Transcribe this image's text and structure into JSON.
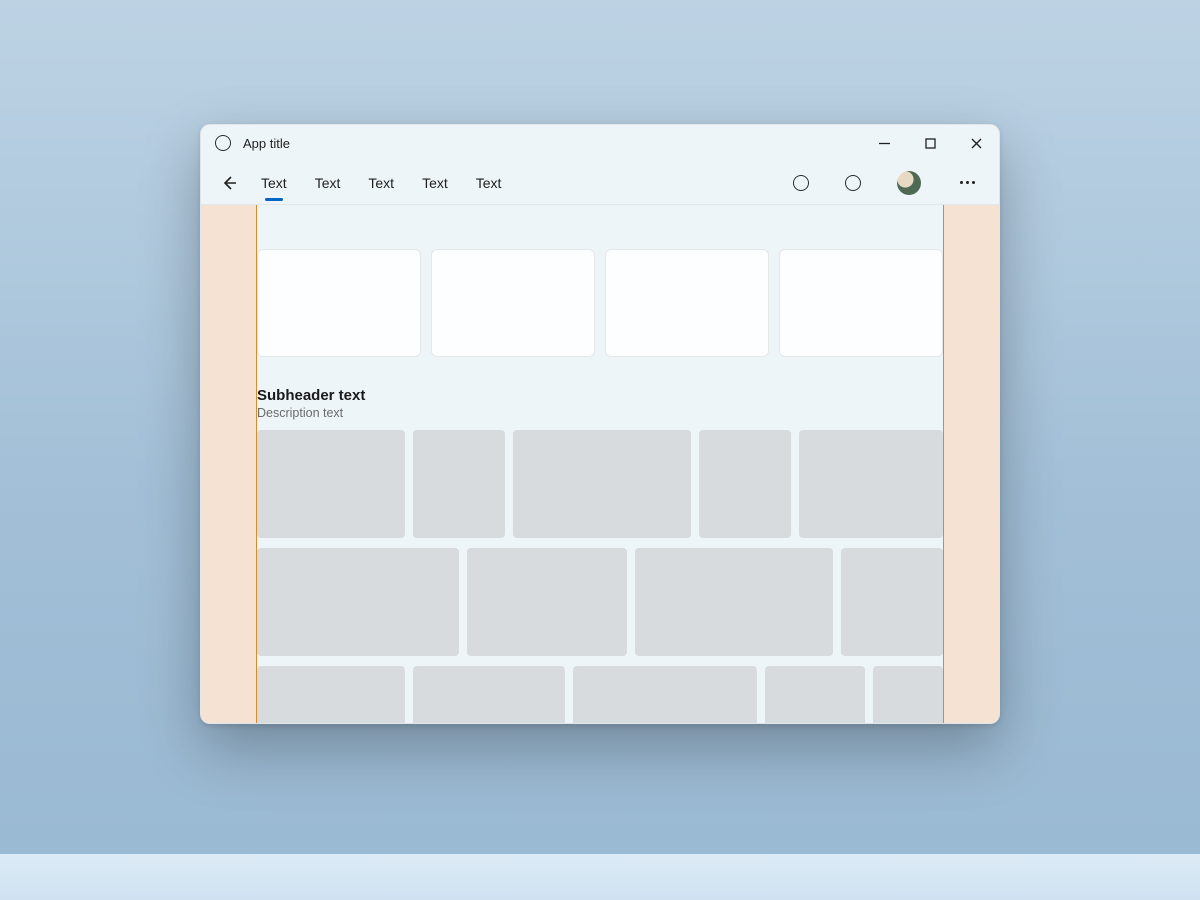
{
  "titlebar": {
    "app_title": "App title"
  },
  "nav": {
    "tabs": [
      {
        "label": "Text",
        "active": true
      },
      {
        "label": "Text",
        "active": false
      },
      {
        "label": "Text",
        "active": false
      },
      {
        "label": "Text",
        "active": false
      },
      {
        "label": "Text",
        "active": false
      }
    ]
  },
  "section": {
    "subheader": "Subheader text",
    "description": "Description text"
  }
}
